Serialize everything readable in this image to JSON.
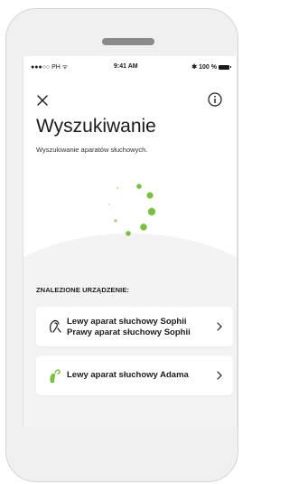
{
  "statusbar": {
    "carrier": "●●●○○ PH ᯤ",
    "time": "9:41 AM",
    "battery": "100 %"
  },
  "header": {
    "title": "Wyszukiwanie",
    "subtitle": "Wyszukiwanie aparatów słuchowych."
  },
  "icons": {
    "close": "close-icon",
    "info": "info-icon",
    "spinner": "loading-spinner",
    "device_outline": "hearing-aid-outline-icon",
    "device_green": "hearing-aid-green-icon",
    "chevron": "chevron-right-icon"
  },
  "colors": {
    "accent": "#7ac142",
    "background": "#f3f3f3",
    "card": "#ffffff"
  },
  "found": {
    "label": "ZNALEZIONE URZĄDZENIE:",
    "devices": [
      {
        "line1": "Lewy aparat słuchowy Sophii",
        "line2": "Prawy aparat słuchowy Sophii"
      },
      {
        "line1": "Lewy aparat słuchowy Adama"
      }
    ]
  }
}
